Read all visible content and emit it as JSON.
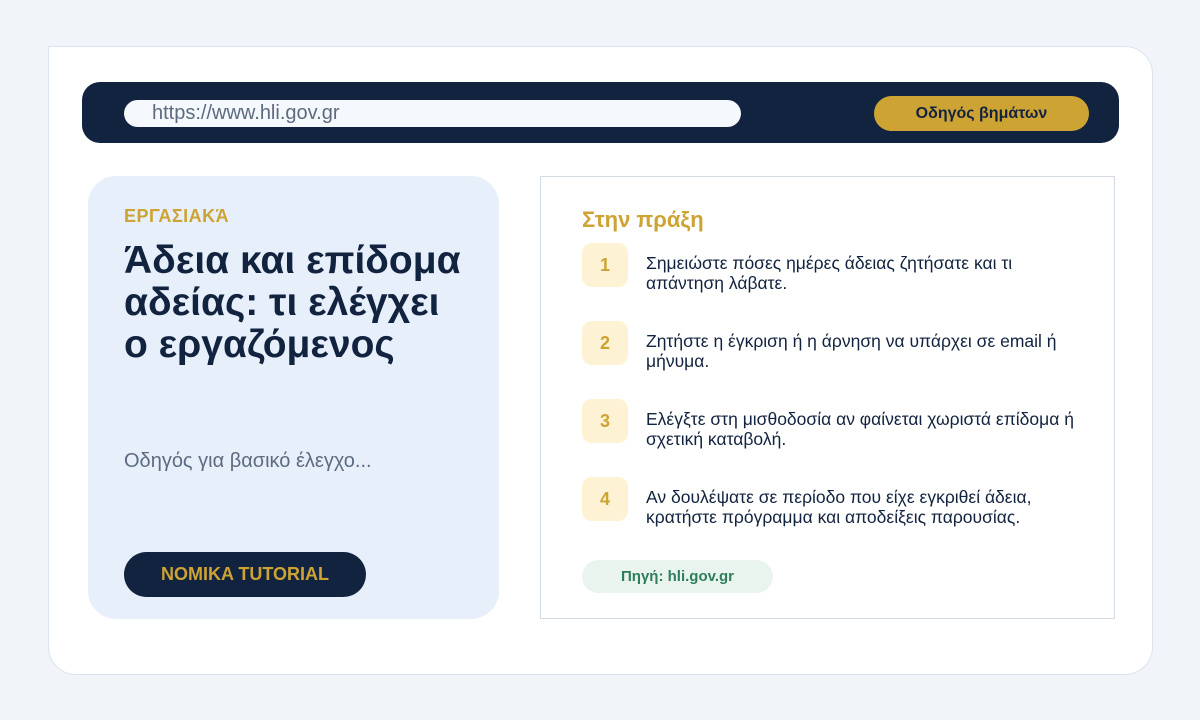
{
  "browser": {
    "url": "https://www.hli.gov.gr",
    "guide_button": "Οδηγός βημάτων"
  },
  "left_card": {
    "category": "ΕΡΓΑΣΙΑΚΆ",
    "title": "Άδεια και επίδομα αδείας: τι ελέγχει ο εργαζόμενος",
    "subtitle": "Οδηγός για βασικό έλεγχο...",
    "tutorial_button": "NOMIKA TUTORIAL"
  },
  "right_card": {
    "section_title": "Στην πράξη",
    "steps": [
      {
        "num": "1",
        "text": "Σημειώστε πόσες ημέρες άδειας ζητήσατε και τι απάντηση λάβατε."
      },
      {
        "num": "2",
        "text": "Ζητήστε η έγκριση ή η άρνηση να υπάρχει σε email ή μήνυμα."
      },
      {
        "num": "3",
        "text": "Ελέγξτε στη μισθοδοσία αν φαίνεται χωριστά επίδομα ή σχετική καταβολή."
      },
      {
        "num": "4",
        "text": "Αν δουλέψατε σε περίοδο που είχε εγκριθεί άδεια, κρατήστε πρόγραμμα και αποδείξεις παρουσίας."
      }
    ],
    "source": "Πηγή: hli.gov.gr"
  },
  "colors": {
    "navy": "#12233f",
    "gold": "#cda334",
    "card_bg": "#e7f0fa",
    "source_green": "#2e7e5a"
  }
}
